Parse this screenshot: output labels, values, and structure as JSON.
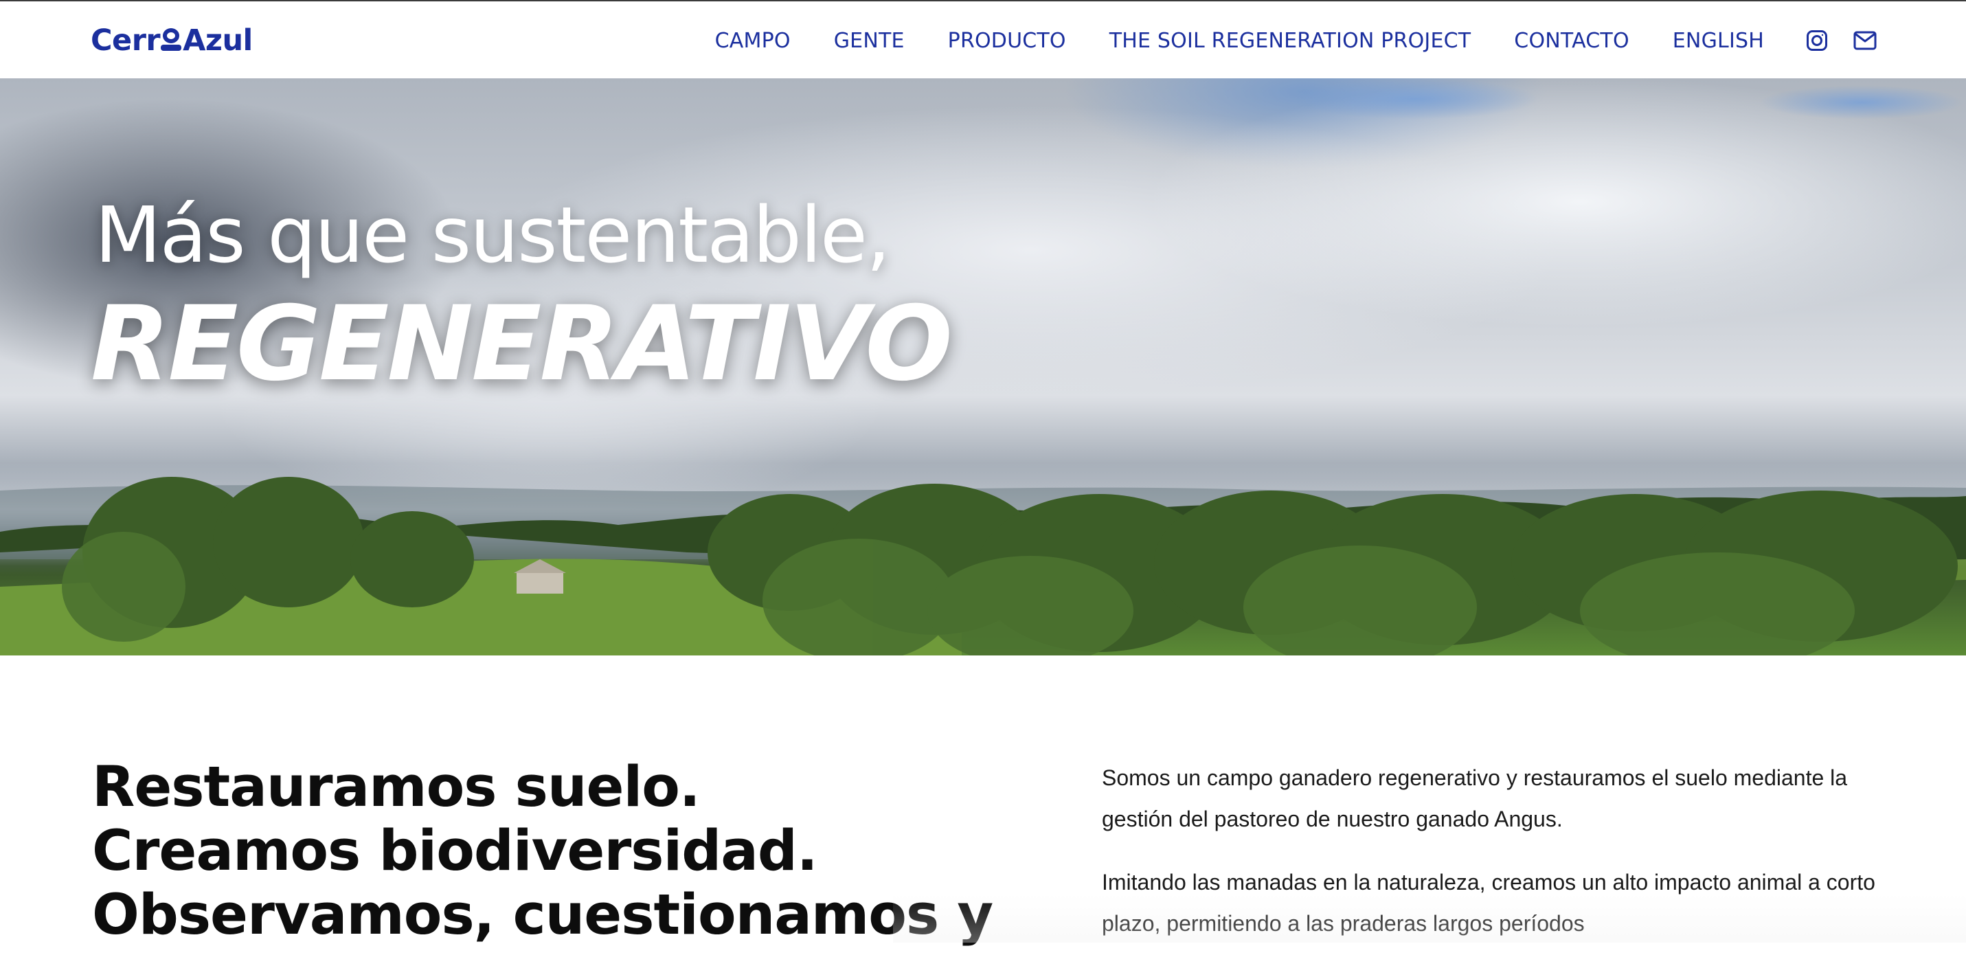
{
  "header": {
    "logo_left": "Cerr",
    "logo_right": "Azul",
    "nav": [
      {
        "label": "CAMPO"
      },
      {
        "label": "GENTE"
      },
      {
        "label": "PRODUCTO"
      },
      {
        "label": "THE SOIL REGENERATION PROJECT"
      },
      {
        "label": "CONTACTO"
      },
      {
        "label": "ENGLISH"
      }
    ],
    "icons": [
      "instagram-icon",
      "mail-icon"
    ]
  },
  "hero": {
    "title": "Más que sustentable,",
    "title_strong": "REGENERATIVO"
  },
  "intro": {
    "headline": [
      "Restauramos suelo.",
      "Creamos biodiversidad.",
      "Observamos, cuestionamos y"
    ],
    "paragraphs": [
      "Somos un campo ganadero regenerativo y restauramos el suelo mediante la gestión del pastoreo de nuestro ganado Angus.",
      "Imitando las manadas en la naturaleza, creamos un alto impacto animal a corto plazo, permitiendo a las praderas largos períodos"
    ]
  },
  "colors": {
    "brand": "#1b2f9e",
    "text": "#0d0d0d",
    "background": "#ffffff"
  }
}
